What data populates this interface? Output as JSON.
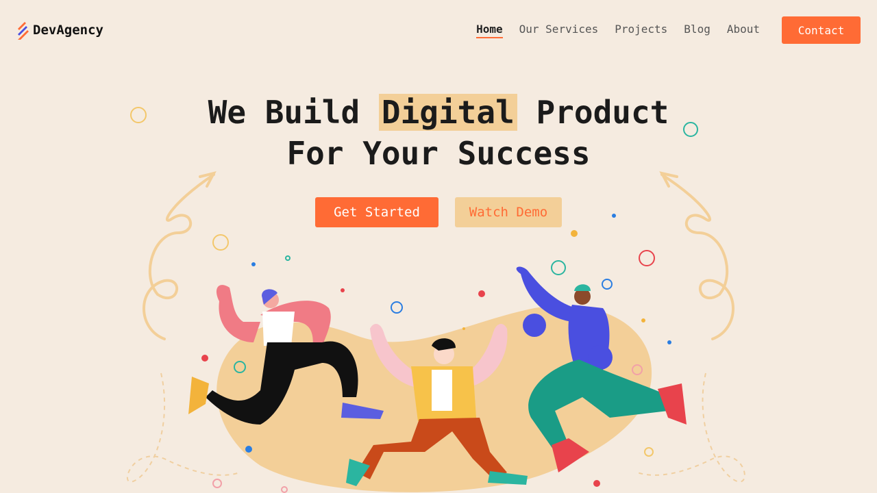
{
  "brand": {
    "name": "DevAgency",
    "icon": "lightning-stripes-logo"
  },
  "nav": {
    "items": [
      {
        "label": "Home",
        "active": true
      },
      {
        "label": "Our Services",
        "active": false
      },
      {
        "label": "Projects",
        "active": false
      },
      {
        "label": "Blog",
        "active": false
      },
      {
        "label": "About",
        "active": false
      }
    ],
    "contact_label": "Contact"
  },
  "hero": {
    "title_line1_before": "We Build",
    "title_highlight": "Digital",
    "title_line1_after": "Product",
    "title_line2": "For Your Success",
    "primary_cta": "Get Started",
    "secondary_cta": "Watch Demo"
  },
  "colors": {
    "background": "#f5ebe0",
    "accent": "#ff6b35",
    "highlight": "#f3cf98"
  },
  "illustration": {
    "name": "three-people-running-illustration"
  }
}
